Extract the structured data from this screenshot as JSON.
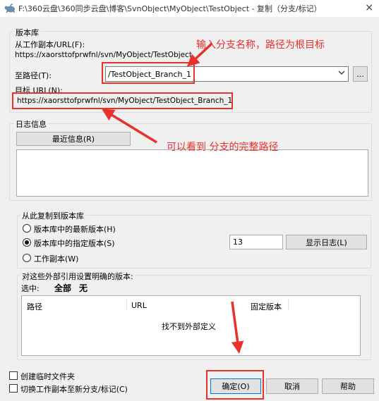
{
  "window": {
    "title": "F:\\360云盘\\360同步云盘\\博客\\SvnObject\\MyObject\\TestObject - 复制（分支/标记）",
    "close": "×"
  },
  "repository": {
    "group_label": "版本库",
    "from_label": "从工作副本/URL(F):",
    "from_url": "https://xaorsttofprwfnl/svn/MyObject/TestObject",
    "to_label": "至路径(T):",
    "to_value": "/TestObject_Branch_1",
    "browse_label": "...",
    "target_label": "目标 URL(N):",
    "target_url": "https://xaorsttofprwfnl/svn/MyObject/TestObject_Branch_1"
  },
  "log": {
    "group_label": "日志信息",
    "recent_button": "最近信息(R)",
    "message": ""
  },
  "copy_from": {
    "group_label": "从此复制到版本库",
    "options": [
      {
        "label": "版本库中的最新版本(H)",
        "selected": false
      },
      {
        "label": "版本库中的指定版本(S)",
        "selected": true
      },
      {
        "label": "工作副本(W)",
        "selected": false
      }
    ],
    "revision": "13",
    "show_log_button": "显示日志(L)"
  },
  "externals": {
    "group_label": "对这些外部引用设置明确的版本:",
    "select_label": "选中:",
    "select_all": "全部",
    "select_none": "无",
    "columns": [
      "路径",
      "URL",
      "固定版本"
    ],
    "empty_text": "找不到外部定义"
  },
  "options": {
    "create_intermediate": {
      "label": "创建临时文件夹",
      "checked": false
    },
    "switch_working_copy": {
      "label": "切换工作副本至新分支/标记(C)",
      "checked": false
    }
  },
  "buttons": {
    "ok": "确定(O)",
    "cancel": "取消",
    "help": "帮助"
  },
  "annotations": {
    "branch_name": "输入分支名称，路径为根目标",
    "full_path": "可以看到 分支的完整路径"
  },
  "colors": {
    "highlight": "#e8302c",
    "background": "#f0f0f0"
  }
}
